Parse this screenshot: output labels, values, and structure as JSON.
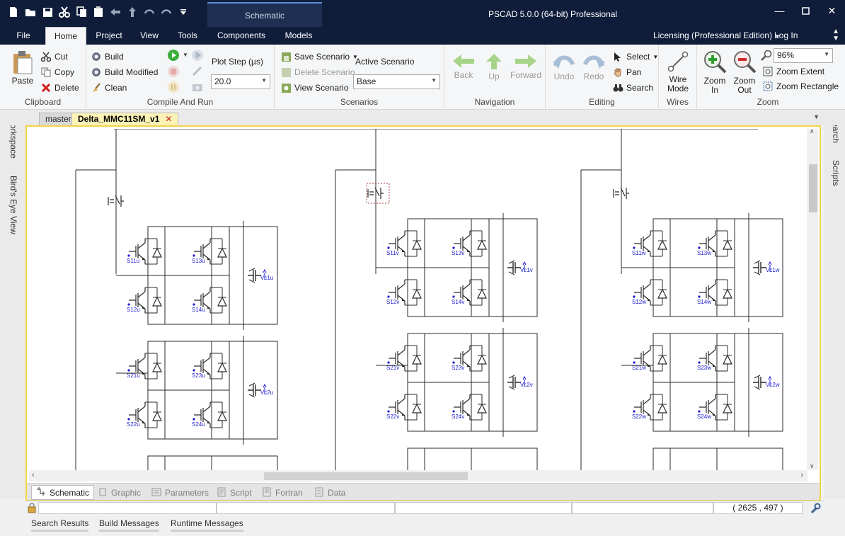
{
  "app_title": "PSCAD 5.0.0 (64-bit) Professional",
  "context_tab": "Schematic",
  "ribbon_tabs": [
    "File",
    "Home",
    "Project",
    "View",
    "Tools",
    "Components",
    "Models"
  ],
  "licensing_label": "Licensing (Professional Edition)",
  "login_label": "Log In",
  "clipboard": {
    "paste": "Paste",
    "cut": "Cut",
    "copy": "Copy",
    "delete": "Delete",
    "label": "Clipboard"
  },
  "compile": {
    "build": "Build",
    "build_modified": "Build Modified",
    "clean": "Clean",
    "plot_step_label": "Plot Step (µs)",
    "plot_step_value": "20.0",
    "label": "Compile And Run"
  },
  "scenarios": {
    "save": "Save Scenario",
    "delete": "Delete Scenario",
    "view": "View Scenario",
    "active_label": "Active Scenario",
    "active_value": "Base",
    "label": "Scenarios"
  },
  "navigation": {
    "back": "Back",
    "up": "Up",
    "forward": "Forward",
    "label": "Navigation"
  },
  "editing": {
    "undo": "Undo",
    "redo": "Redo",
    "select": "Select",
    "pan": "Pan",
    "search": "Search",
    "label": "Editing"
  },
  "wires": {
    "wire_mode": "Wire Mode",
    "label": "Wires"
  },
  "zoom": {
    "zoom_in": "Zoom In",
    "zoom_out": "Zoom Out",
    "level": "96%",
    "extent": "Zoom Extent",
    "rectangle": "Zoom Rectangle",
    "label": "Zoom"
  },
  "doc_tabs": [
    "master",
    "Delta_MMC11SM_v1"
  ],
  "left_panes": [
    "Workspace",
    "Bird's Eye View"
  ],
  "right_panes": [
    "Search",
    "Scripts"
  ],
  "sub_tabs": [
    "Schematic",
    "Graphic",
    "Parameters",
    "Script",
    "Fortran",
    "Data"
  ],
  "coords": "( 2625 , 497 )",
  "bottom_tabs": [
    "Search Results",
    "Build Messages",
    "Runtime Messages"
  ],
  "schematic": {
    "columns": [
      {
        "phase": "u",
        "cells": [
          {
            "switches": [
              "S11u",
              "S12u",
              "S13u",
              "S14u"
            ],
            "cap": "Vc1u"
          },
          {
            "switches": [
              "S21u",
              "S22u",
              "S23u",
              "S24u"
            ],
            "cap": "Vc2u"
          }
        ]
      },
      {
        "phase": "v",
        "cells": [
          {
            "switches": [
              "S11v",
              "S12v",
              "S13v",
              "S14v"
            ],
            "cap": "Vc1v"
          },
          {
            "switches": [
              "S21v",
              "S22v",
              "S23v",
              "S24v"
            ],
            "cap": "Vc2v"
          }
        ]
      },
      {
        "phase": "w",
        "cells": [
          {
            "switches": [
              "S11w",
              "S12w",
              "S13w",
              "S14w"
            ],
            "cap": "Vc1w"
          },
          {
            "switches": [
              "S21w",
              "S22w",
              "S23w",
              "S24w"
            ],
            "cap": "Vc2w"
          }
        ]
      }
    ]
  }
}
